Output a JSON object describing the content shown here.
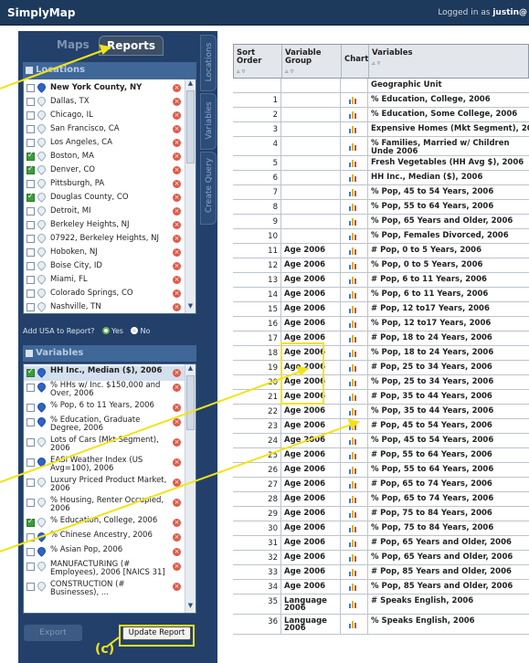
{
  "app": {
    "name": "SimplyMap",
    "login_prefix": "Logged in as ",
    "user": "justin@"
  },
  "tabs": {
    "maps": "Maps",
    "reports": "Reports"
  },
  "side_tabs": [
    "Locations",
    "Variables",
    "Create Query"
  ],
  "locations": {
    "title": "Locations",
    "items": [
      {
        "label": "New York County, NY",
        "checked": false,
        "bold": true,
        "pin": "blue"
      },
      {
        "label": "Dallas, TX",
        "checked": false,
        "pin": "gray"
      },
      {
        "label": "Chicago, IL",
        "checked": false,
        "pin": "gray"
      },
      {
        "label": "San Francisco, CA",
        "checked": false,
        "pin": "gray"
      },
      {
        "label": "Los Angeles, CA",
        "checked": false,
        "pin": "gray"
      },
      {
        "label": "Boston, MA",
        "checked": true,
        "pin": "gray"
      },
      {
        "label": "Denver, CO",
        "checked": true,
        "pin": "gray"
      },
      {
        "label": "Pittsburgh, PA",
        "checked": false,
        "pin": "gray"
      },
      {
        "label": "Douglas County, CO",
        "checked": true,
        "pin": "gray"
      },
      {
        "label": "Detroit, MI",
        "checked": false,
        "pin": "gray"
      },
      {
        "label": "Berkeley Heights, NJ",
        "checked": false,
        "pin": "gray"
      },
      {
        "label": "07922, Berkeley Heights, NJ",
        "checked": false,
        "pin": "gray"
      },
      {
        "label": "Hoboken, NJ",
        "checked": false,
        "pin": "gray"
      },
      {
        "label": "Boise City, ID",
        "checked": false,
        "pin": "gray"
      },
      {
        "label": "Miami, FL",
        "checked": false,
        "pin": "gray"
      },
      {
        "label": "Colorado Springs, CO",
        "checked": false,
        "pin": "gray"
      },
      {
        "label": "Nashville, TN",
        "checked": false,
        "pin": "gray"
      }
    ]
  },
  "usa": {
    "label": "Add USA to Report?",
    "yes": "Yes",
    "no": "No"
  },
  "variables": {
    "title": "Variables",
    "items": [
      {
        "label": "HH Inc., Median ($), 2006",
        "checked": true,
        "bold": true,
        "pin": "blue"
      },
      {
        "label": "% HHs w/ Inc. $150,000 and Over, 2006",
        "checked": false,
        "pin": "blue"
      },
      {
        "label": "% Pop, 6 to 11 Years, 2006",
        "checked": false,
        "pin": "blue"
      },
      {
        "label": "% Education, Graduate Degree, 2006",
        "checked": false,
        "pin": "blue"
      },
      {
        "label": "Lots of Cars (Mkt Segment), 2006",
        "checked": false,
        "pin": "gray"
      },
      {
        "label": "EASI Weather Index (US Avg=100), 2006",
        "checked": false,
        "pin": "blue"
      },
      {
        "label": "Luxury Priced Product Market, 2006",
        "checked": false,
        "pin": "gray"
      },
      {
        "label": "% Housing, Renter Occupied, 2006",
        "checked": false,
        "pin": "gray"
      },
      {
        "label": "% Education, College, 2006",
        "checked": true,
        "pin": "gray"
      },
      {
        "label": "% Chinese Ancestry, 2006",
        "checked": false,
        "pin": "blue"
      },
      {
        "label": "% Asian Pop, 2006",
        "checked": false,
        "pin": "blue"
      },
      {
        "label": "MANUFACTURING (# Employees), 2006 [NAICS 31]",
        "checked": false,
        "pin": "gray"
      },
      {
        "label": "CONSTRUCTION (# Businesses), ...",
        "checked": false,
        "pin": "gray"
      }
    ]
  },
  "buttons": {
    "export": "Export",
    "update": "Update Report"
  },
  "table": {
    "headers": {
      "sort": "Sort Order",
      "group": "Variable Group",
      "chart": "Chart",
      "variables": "Variables"
    },
    "geo_label": "Geographic Unit",
    "rows": [
      {
        "n": "1",
        "group": "",
        "var": "% Education, College, 2006"
      },
      {
        "n": "2",
        "group": "",
        "var": "% Education, Some College, 2006"
      },
      {
        "n": "3",
        "group": "",
        "var": "Expensive Homes (Mkt Segment), 200"
      },
      {
        "n": "4",
        "group": "",
        "var": "% Families, Married w/ Children Unde 2006"
      },
      {
        "n": "5",
        "group": "",
        "var": "Fresh Vegetables (HH Avg $), 2006"
      },
      {
        "n": "6",
        "group": "",
        "var": "HH Inc., Median ($), 2006"
      },
      {
        "n": "7",
        "group": "",
        "var": "% Pop, 45 to 54 Years, 2006"
      },
      {
        "n": "8",
        "group": "",
        "var": "% Pop, 55 to 64 Years, 2006"
      },
      {
        "n": "9",
        "group": "",
        "var": "% Pop, 65 Years and Older, 2006"
      },
      {
        "n": "10",
        "group": "",
        "var": "% Pop, Females Divorced, 2006"
      },
      {
        "n": "11",
        "group": "Age 2006",
        "var": "# Pop, 0 to 5 Years, 2006"
      },
      {
        "n": "12",
        "group": "Age 2006",
        "var": "% Pop, 0 to 5 Years, 2006"
      },
      {
        "n": "13",
        "group": "Age 2006",
        "var": "# Pop, 6 to 11 Years, 2006"
      },
      {
        "n": "14",
        "group": "Age 2006",
        "var": "% Pop, 6 to 11 Years, 2006"
      },
      {
        "n": "15",
        "group": "Age 2006",
        "var": "# Pop, 12 to17 Years, 2006"
      },
      {
        "n": "16",
        "group": "Age 2006",
        "var": "% Pop, 12 to17 Years, 2006"
      },
      {
        "n": "17",
        "group": "Age 2006",
        "var": "# Pop, 18 to 24 Years, 2006"
      },
      {
        "n": "18",
        "group": "Age 2006",
        "var": "% Pop, 18 to 24 Years, 2006"
      },
      {
        "n": "19",
        "group": "Age 2006",
        "var": "# Pop, 25 to 34 Years, 2006"
      },
      {
        "n": "20",
        "group": "Age 2006",
        "var": "% Pop, 25 to 34 Years, 2006"
      },
      {
        "n": "21",
        "group": "Age 2006",
        "var": "# Pop, 35 to 44 Years, 2006"
      },
      {
        "n": "22",
        "group": "Age 2006",
        "var": "% Pop, 35 to 44 Years, 2006"
      },
      {
        "n": "23",
        "group": "Age 2006",
        "var": "# Pop, 45 to 54 Years, 2006"
      },
      {
        "n": "24",
        "group": "Age 2006",
        "var": "% Pop, 45 to 54 Years, 2006"
      },
      {
        "n": "25",
        "group": "Age 2006",
        "var": "# Pop, 55 to 64 Years, 2006"
      },
      {
        "n": "26",
        "group": "Age 2006",
        "var": "% Pop, 55 to 64 Years, 2006"
      },
      {
        "n": "27",
        "group": "Age 2006",
        "var": "# Pop, 65 to 74 Years, 2006"
      },
      {
        "n": "28",
        "group": "Age 2006",
        "var": "% Pop, 65 to 74 Years, 2006"
      },
      {
        "n": "29",
        "group": "Age 2006",
        "var": "# Pop, 75 to 84 Years, 2006"
      },
      {
        "n": "30",
        "group": "Age 2006",
        "var": "% Pop, 75 to 84 Years, 2006"
      },
      {
        "n": "31",
        "group": "Age 2006",
        "var": "# Pop, 65 Years and Older, 2006"
      },
      {
        "n": "32",
        "group": "Age 2006",
        "var": "% Pop, 65 Years and Older, 2006"
      },
      {
        "n": "33",
        "group": "Age 2006",
        "var": "# Pop, 85 Years and Older, 2006"
      },
      {
        "n": "34",
        "group": "Age 2006",
        "var": "% Pop, 85 Years and Older, 2006"
      },
      {
        "n": "35",
        "group": "Language 2006",
        "var": "# Speaks English, 2006"
      },
      {
        "n": "36",
        "group": "Language 2006",
        "var": "% Speaks English, 2006"
      }
    ]
  },
  "annotation": {
    "label": "(c)"
  },
  "colors": {
    "header_bg": "#1d3a5c",
    "panel_bg": "#23406a",
    "annotation": "#f2e317"
  }
}
